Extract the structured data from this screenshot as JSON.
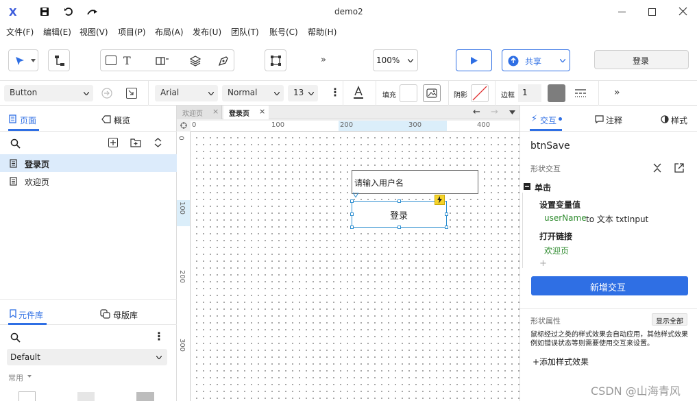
{
  "window": {
    "title": "demo2",
    "logo": "X"
  },
  "menu": [
    "文件(F)",
    "编辑(E)",
    "视图(V)",
    "项目(P)",
    "布局(A)",
    "发布(U)",
    "团队(T)",
    "账号(C)",
    "帮助(H)"
  ],
  "toolbar": {
    "zoom": "100%",
    "share_label": "共享",
    "login_label": "登录"
  },
  "format": {
    "widget_type": "Button",
    "font": "Arial",
    "weight": "Normal",
    "size": "13",
    "fill_label": "填充",
    "shadow_label": "阴影",
    "border_label": "边框",
    "border_width": "1"
  },
  "left": {
    "tab_pages": "页面",
    "tab_outline": "概览",
    "pages": [
      "登录页",
      "欢迎页"
    ],
    "tab_library": "元件库",
    "tab_masters": "母版库",
    "library_select": "Default",
    "category": "常用"
  },
  "canvas": {
    "tabs": [
      "欢迎页",
      "登录页"
    ],
    "ruler_h": [
      "0",
      "100",
      "200",
      "300",
      "400"
    ],
    "ruler_v": [
      "0",
      "100",
      "200",
      "300"
    ],
    "input_text": "请输入用户名",
    "button_text": "登录"
  },
  "right": {
    "tab_interaction": "交互",
    "tab_notes": "注释",
    "tab_style": "样式",
    "widget_name": "btnSave",
    "section_interaction": "形状交互",
    "event": "单击",
    "action1": "设置变量值",
    "action1_var": "userName",
    "action1_rest": " to 文本 txtInput",
    "action2": "打开链接",
    "action2_target": "欢迎页",
    "add_interaction": "新增交互",
    "section_props": "形状属性",
    "show_all": "显示全部",
    "props_desc": "鼠标经过之类的样式效果会自动应用，其他样式效果例如错误状态等则需要使用交互来设置。",
    "add_style": "+添加样式效果"
  },
  "watermark": "CSDN @山海青风",
  "colors": {
    "accent": "#2f6fe4",
    "green": "#2e8b2e",
    "primary_btn": "#2f6fe4"
  }
}
